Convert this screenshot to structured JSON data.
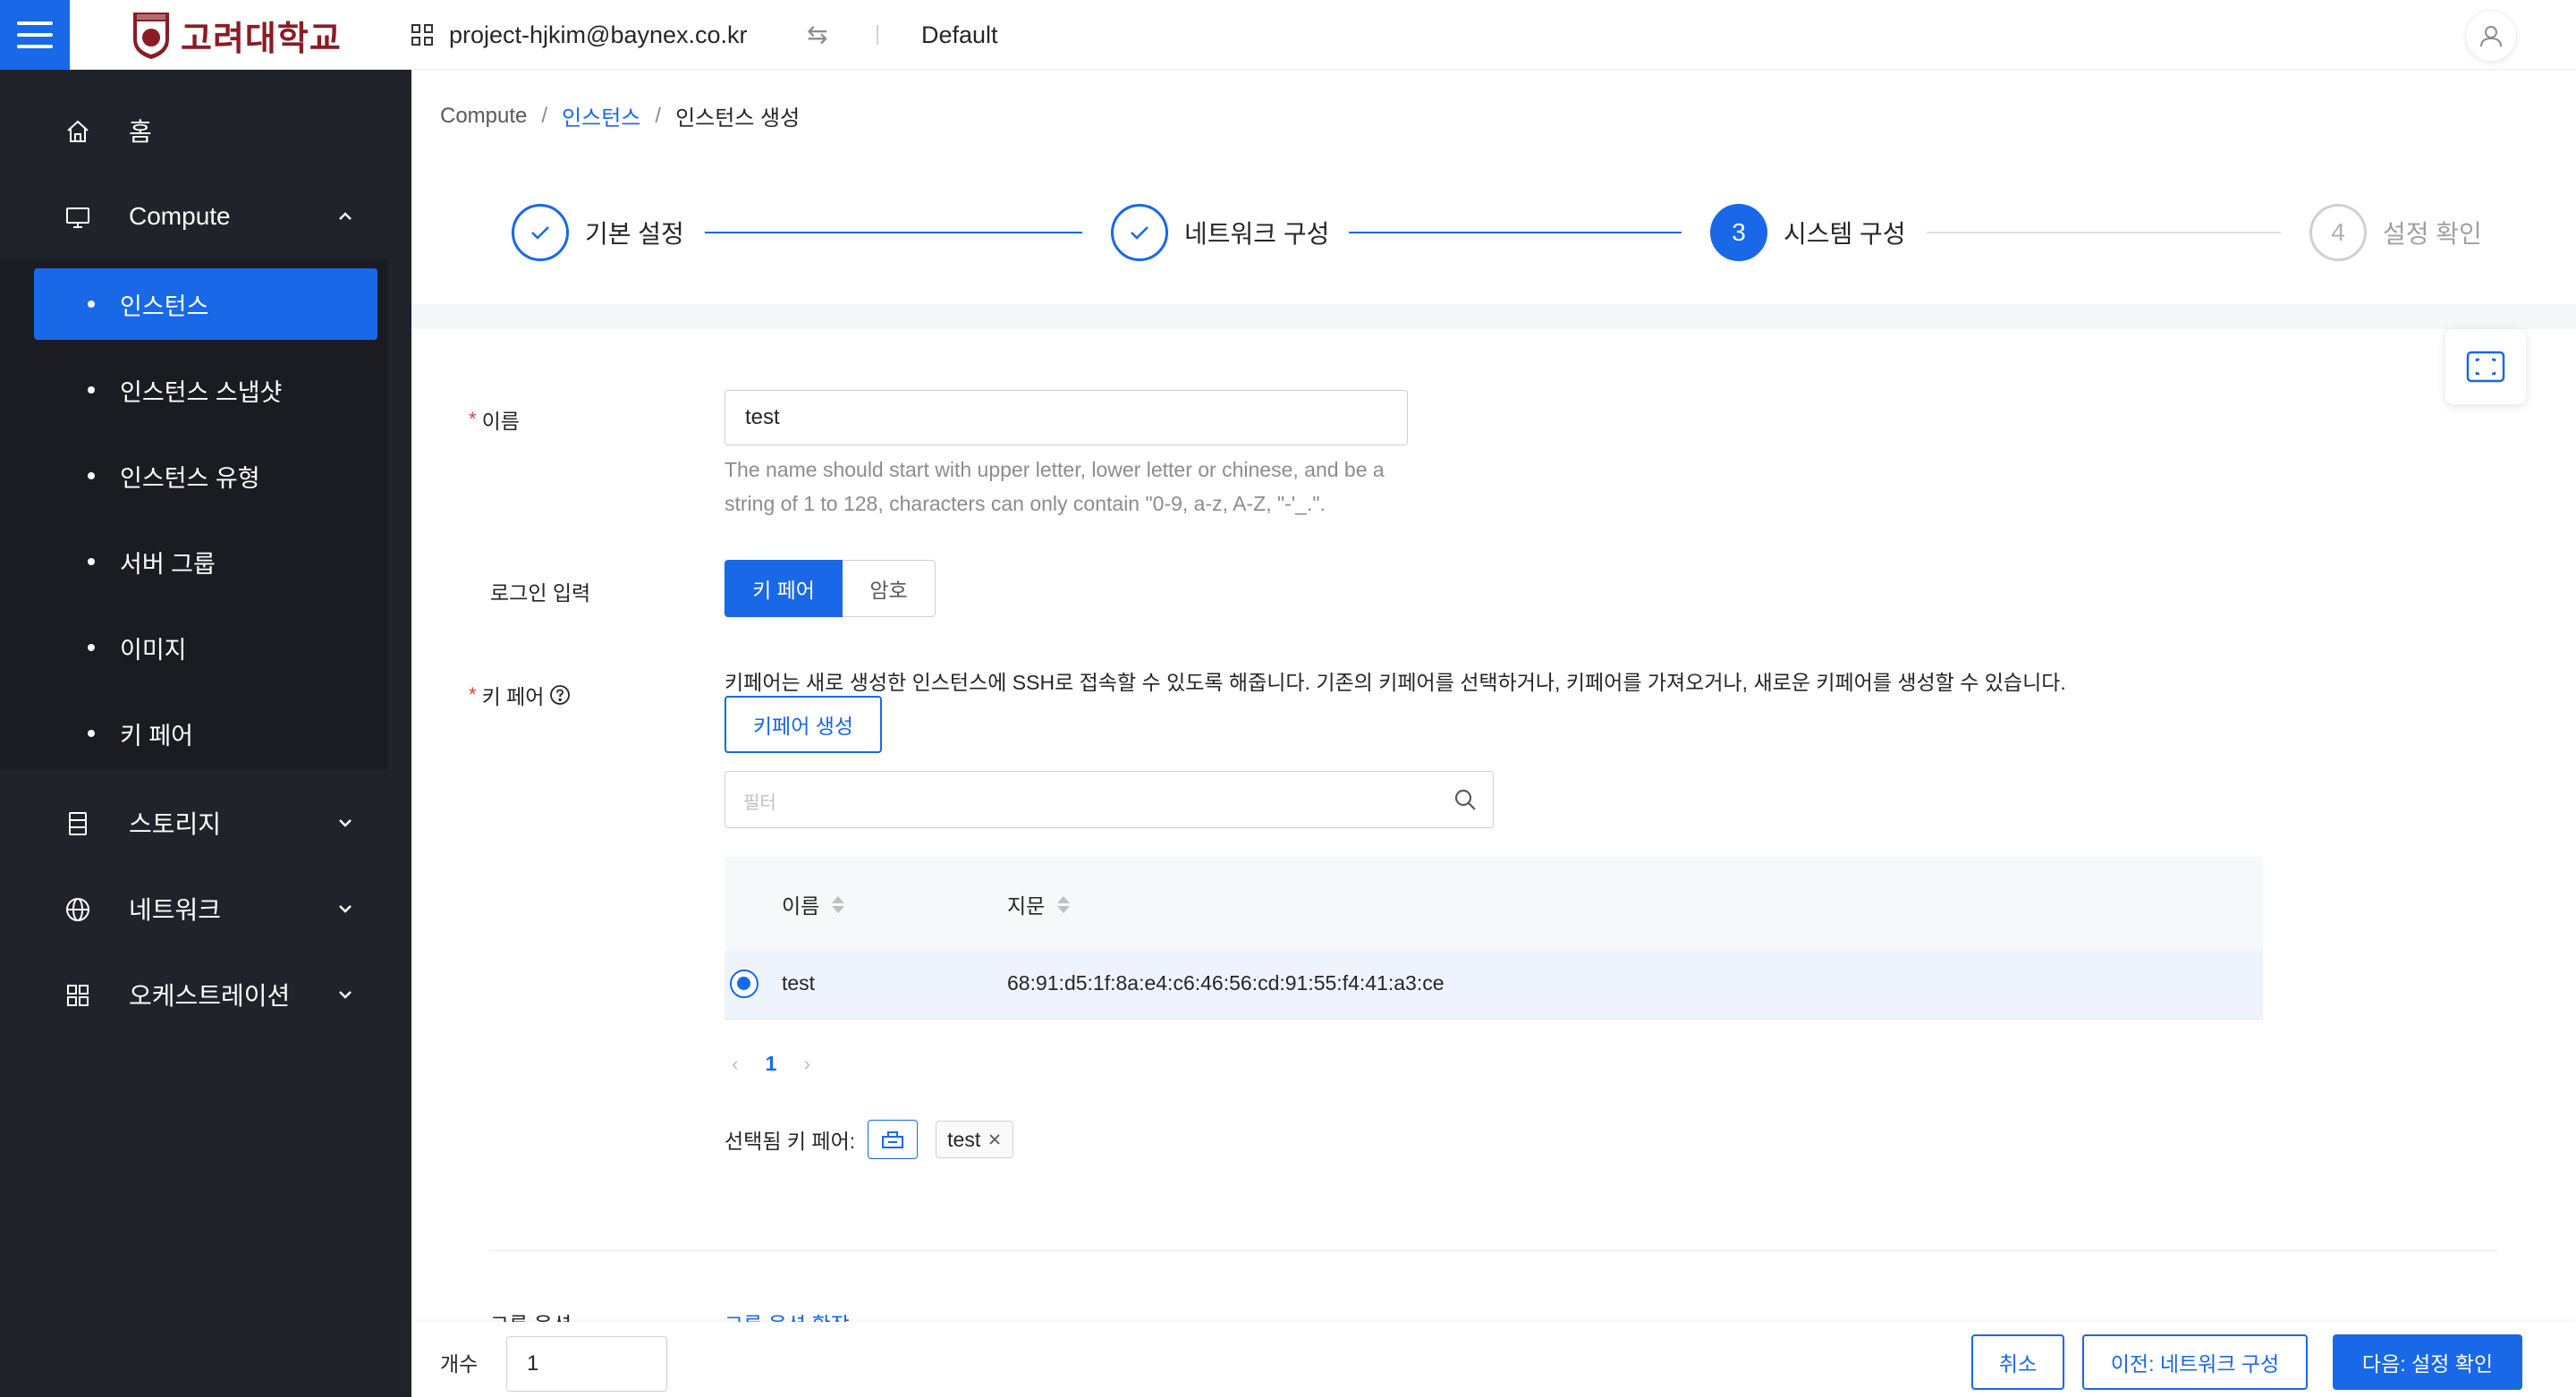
{
  "header": {
    "university": "고려대학교",
    "project": "project-hjkim@baynex.co.kr",
    "domain": "Default"
  },
  "sidebar": {
    "items": [
      {
        "label": "홈",
        "icon": "home-icon"
      },
      {
        "label": "Compute",
        "icon": "monitor-icon"
      },
      {
        "label": "스토리지",
        "icon": "database-icon"
      },
      {
        "label": "네트워크",
        "icon": "globe-icon"
      },
      {
        "label": "오케스트레이션",
        "icon": "grid-icon"
      }
    ],
    "compute_sub": [
      {
        "label": "인스턴스",
        "active": true
      },
      {
        "label": "인스턴스 스냅샷"
      },
      {
        "label": "인스턴스 유형"
      },
      {
        "label": "서버 그룹"
      },
      {
        "label": "이미지"
      },
      {
        "label": "키 페어"
      }
    ]
  },
  "breadcrumb": [
    "Compute",
    "인스턴스",
    "인스턴스 생성"
  ],
  "steps": [
    {
      "label": "기본 설정",
      "state": "done"
    },
    {
      "label": "네트워크 구성",
      "state": "done"
    },
    {
      "num": "3",
      "label": "시스템 구성",
      "state": "current"
    },
    {
      "num": "4",
      "label": "설정 확인",
      "state": "pending"
    }
  ],
  "form": {
    "name_label": "이름",
    "name_value": "test",
    "name_help": "The name should start with upper letter, lower letter or chinese, and be a string of 1 to 128, characters can only contain \"0-9, a-z, A-Z, \"-'_.\".",
    "login_label": "로그인 입력",
    "login_options": [
      "키 페어",
      "암호"
    ],
    "keypair_label": "키 페어",
    "keypair_desc": "키페어는 새로 생성한 인스턴스에 SSH로 접속할 수 있도록 해줍니다. 기존의 키페어를 선택하거나, 키페어를 가져오거나, 새로운 키페어를 생성할 수 있습니다.",
    "keypair_create": "키페어 생성",
    "filter_placeholder": "필터",
    "table": {
      "columns": [
        "이름",
        "지문"
      ],
      "rows": [
        {
          "name": "test",
          "fingerprint": "68:91:d5:1f:8a:e4:c6:46:56:cd:91:55:f4:41:a3:ce",
          "selected": true
        }
      ]
    },
    "page": "1",
    "selected_label": "선택됨 키 페어:",
    "selected_tag": "test",
    "peek_left": "그룹 옵션",
    "peek_right": "그룹 옵션 확장"
  },
  "footer": {
    "count_label": "개수",
    "count_value": "1",
    "cancel": "취소",
    "prev": "이전: 네트워크 구성",
    "next": "다음: 설정 확인"
  },
  "colors": {
    "primary": "#1868e8",
    "sidebar": "#20232a",
    "brand": "#8b1c24"
  }
}
